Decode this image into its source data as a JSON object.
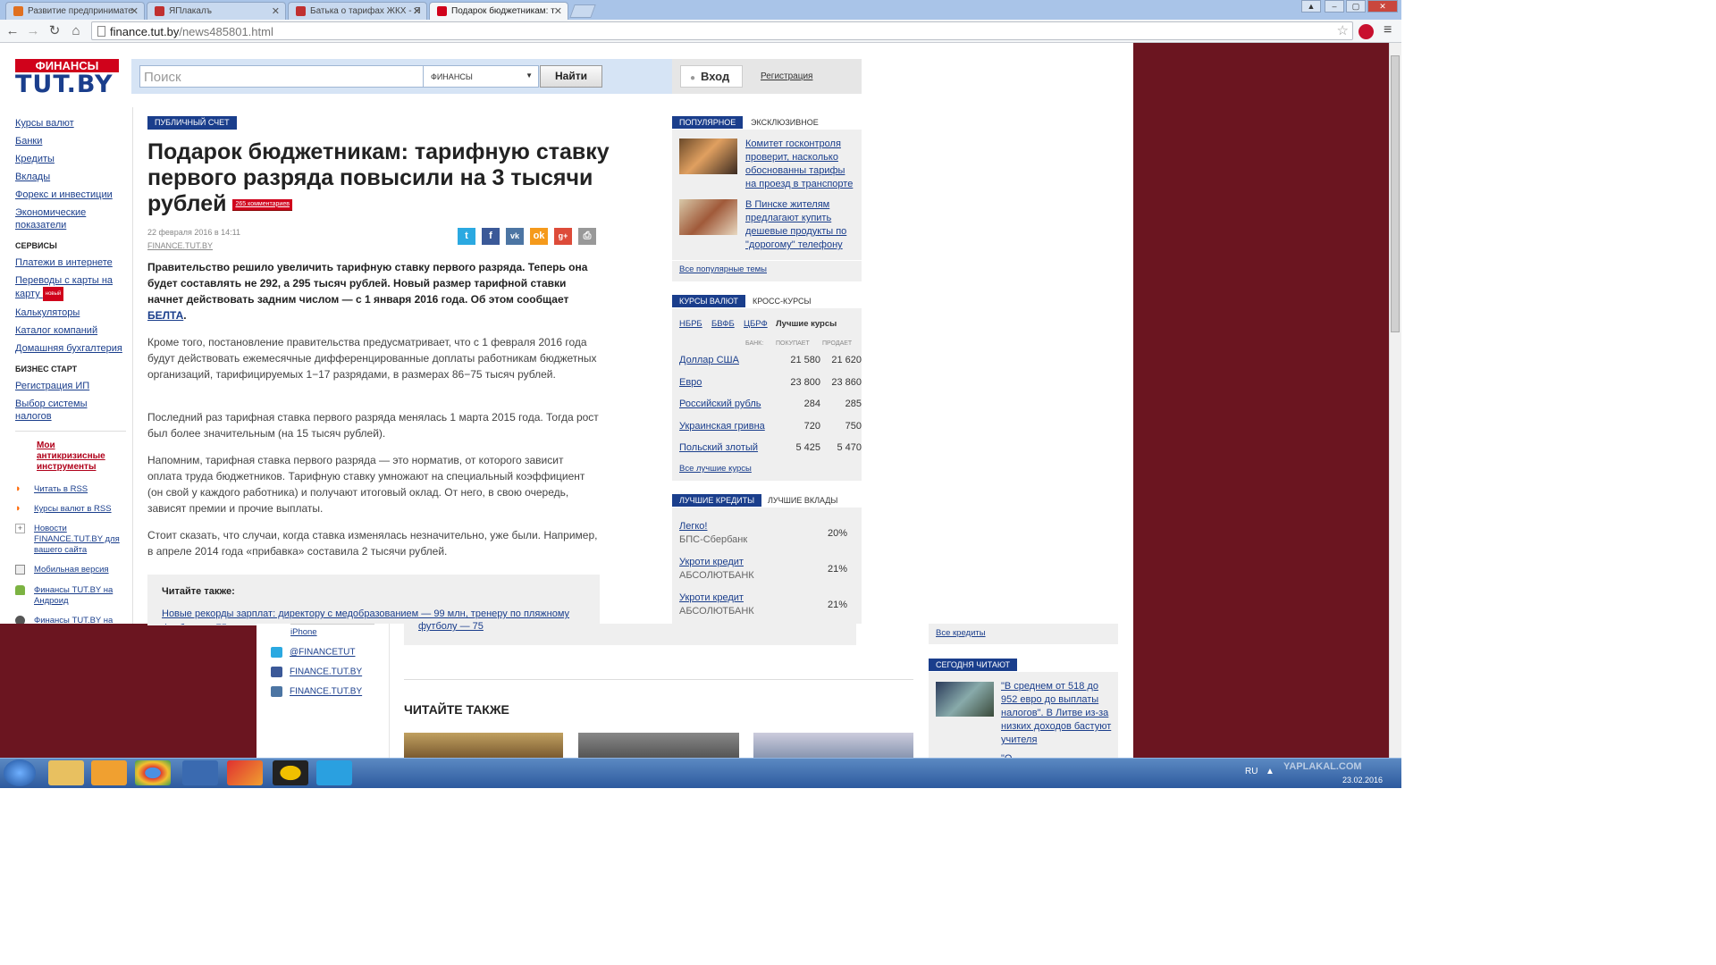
{
  "browser": {
    "tabs": [
      {
        "title": "Развитие предпринимате",
        "color": "#e07020",
        "active": false
      },
      {
        "title": "ЯПлакалъ",
        "color": "#c03030",
        "active": false
      },
      {
        "title": "Батька о тарифах ЖКХ - Я",
        "color": "#c03030",
        "active": false
      },
      {
        "title": "Подарок бюджетникам: т",
        "color": "#d0021b",
        "active": true
      }
    ],
    "url_domain": "finance.tut.by",
    "url_path": "/news485801.html",
    "window_buttons": [
      "–",
      "▢",
      "✕"
    ]
  },
  "header": {
    "logo_top": "ФИНАНСЫ",
    "logo_main": "TUT.BY",
    "search_placeholder": "Поиск",
    "search_section": "ФИНАНСЫ",
    "search_button": "Найти",
    "login_button": "Вход",
    "register_link": "Регистрация"
  },
  "left_nav": {
    "items": [
      "Курсы валют",
      "Банки",
      "Кредиты",
      "Вклады",
      "Форекс и инвестиции",
      "Экономические показатели"
    ],
    "services_title": "СЕРВИСЫ",
    "services": [
      "Платежи в интернете",
      "Переводы с карты на карту",
      "Калькуляторы",
      "Каталог компаний",
      "Домашняя бухгалтерия"
    ],
    "new_badge": "новый",
    "business_title": "БИЗНЕС СТАРТ",
    "business": [
      "Регистрация ИП",
      "Выбор системы налогов"
    ],
    "anticrisis": "Мои антикризисные инструменты",
    "extras": [
      {
        "label": "Читать в RSS",
        "icon": "rss-icon"
      },
      {
        "label": "Курсы валют в RSS",
        "icon": "rss-icon"
      },
      {
        "label": "Новости FINANCE.TUT.BY для вашего сайта",
        "icon": "plus-icon"
      },
      {
        "label": "Мобильная версия",
        "icon": "mobile-icon"
      },
      {
        "label": "Финансы TUT.BY на Андроид",
        "icon": "android-icon"
      },
      {
        "label": "Финансы TUT.BY на",
        "icon": "apple-icon"
      }
    ]
  },
  "article": {
    "rubric": "ПУБЛИЧНЫЙ СЧЕТ",
    "title": "Подарок бюджетникам: тарифную ставку первого разряда повысили на 3 тысячи рублей",
    "comments": "265 комментариев",
    "date": "22 февраля 2016 в 14:11",
    "source": "FINANCE.TUT.BY",
    "lead": "Правительство решило увеличить тарифную ставку первого разряда. Теперь она будет составлять не 292, а 295 тысяч рублей. Новый размер тарифной ставки начнет действовать задним числом — с 1 января 2016 года. Об этом сообщает ",
    "lead_link": "БЕЛТА",
    "paragraphs": [
      "Кроме того, постановление правительства предусматривает, что с 1 февраля 2016 года будут действовать ежемесячные дифференцированные доплаты работникам бюджетных организаций, тарифицируемых 1−17 разрядами, в размерах 86−75 тысяч рублей.",
      "Последний раз тарифная ставка первого разряда менялась 1 марта 2015 года. Тогда рост был более значительным (на 15 тысяч рублей).",
      "Напомним, тарифная ставка первого разряда — это норматив, от которого зависит оплата труда бюджетников. Тарифную ставку умножают на специальный коэффициент (он свой у каждого работника) и получают итоговый оклад. От него, в свою очередь, зависят премии и прочие выплаты.",
      "Стоит сказать, что случаи, когда ставка изменялась незначительно, уже были. Например, в апреле 2014 года «прибавка» составила 2 тысячи рублей."
    ],
    "read_also_title": "Читайте также:",
    "read_also_link": "Новые рекорды зарплат: директору с медобразованием — 99 млн, тренеру по пляжному футболу — 75"
  },
  "sidebar": {
    "popular_tab": "ПОПУЛЯРНОЕ",
    "exclusive_tab": "ЭКСКЛЮЗИВНОЕ",
    "popular": [
      "Комитет госконтроля проверит, насколько обоснованны тарифы на проезд в транспорте",
      "В Пинске жителям предлагают купить дешевые продукты по \"дорогому\" телефону"
    ],
    "popular_all": "Все популярные темы",
    "rates_tab": "КУРСЫ ВАЛЮТ",
    "cross_tab": "КРОСС-КУРСЫ",
    "rates_subtabs": [
      "НБРБ",
      "БВФБ",
      "ЦБРФ"
    ],
    "rates_best": "Лучшие курсы",
    "rates_cols": [
      "БАНК:",
      "ПОКУПАЕТ",
      "ПРОДАЕТ"
    ],
    "rates": [
      {
        "name": "Доллар США",
        "buy": "21 580",
        "sell": "21 620"
      },
      {
        "name": "Евро",
        "buy": "23 800",
        "sell": "23 860"
      },
      {
        "name": "Российский рубль",
        "buy": "284",
        "sell": "285"
      },
      {
        "name": "Украинская гривна",
        "buy": "720",
        "sell": "750"
      },
      {
        "name": "Польский злотый",
        "buy": "5 425",
        "sell": "5 470"
      }
    ],
    "rates_all": "Все лучшие курсы",
    "credits_tab": "ЛУЧШИЕ КРЕДИТЫ",
    "deposits_tab": "ЛУЧШИЕ ВКЛАДЫ",
    "credits": [
      {
        "name": "Легко!",
        "bank": "БПС-Сбербанк",
        "rate": "20%"
      },
      {
        "name": "Укроти кредит",
        "bank": "АБСОЛЮТБАНК",
        "rate": "21%"
      },
      {
        "name": "Укроти кредит",
        "bank": "АБСОЛЮТБАНК",
        "rate": "21%"
      }
    ]
  },
  "overlay": {
    "iphone": "iPhone",
    "social": [
      {
        "label": "@FINANCETUT",
        "icon": "twitter-icon"
      },
      {
        "label": "FINANCE.TUT.BY",
        "icon": "facebook-icon"
      },
      {
        "label": "FINANCE.TUT.BY",
        "icon": "vk-icon"
      }
    ],
    "continued_link": "футболу — 75",
    "read_also_heading": "ЧИТАЙТЕ ТАКЖЕ",
    "all_credits": "Все кредиты",
    "today_tab": "СЕГОДНЯ ЧИТАЮТ",
    "today_item": "\"В среднем от 518 до 952 евро до выплаты налогов\". В Литве из-за низких доходов бастуют учителя",
    "today_next": "\"О"
  },
  "taskbar": {
    "lang": "RU",
    "date": "23.02.2016",
    "watermark": "YAPLAKAL.COM"
  }
}
